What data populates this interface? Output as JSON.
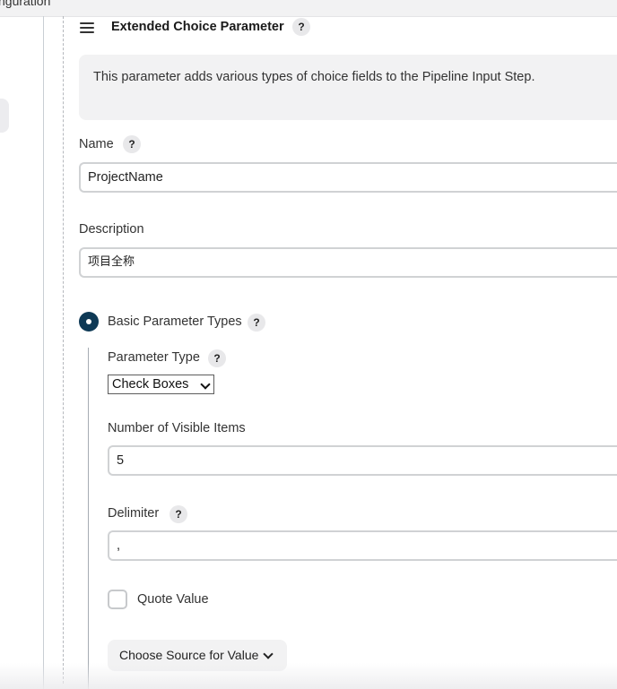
{
  "header": {
    "fragment_text": "nguration"
  },
  "section": {
    "title": "Extended Choice Parameter",
    "help": "?",
    "description": "This parameter adds various types of choice fields to the Pipeline Input Step."
  },
  "name_field": {
    "label": "Name",
    "help": "?",
    "value": "ProjectName"
  },
  "description_field": {
    "label": "Description",
    "value": "项目全称"
  },
  "basic_types": {
    "label": "Basic Parameter Types",
    "help": "?",
    "selected": true,
    "parameter_type": {
      "label": "Parameter Type",
      "help": "?",
      "selected_value": "Check Boxes"
    },
    "visible_items": {
      "label": "Number of Visible Items",
      "value": "5"
    },
    "delimiter": {
      "label": "Delimiter",
      "help": "?",
      "value": ","
    },
    "quote_value": {
      "label": "Quote Value",
      "checked": false
    },
    "source_button": {
      "label": "Choose Source for Value"
    }
  },
  "icons": {
    "drag_handle": "drag-handle-icon",
    "help": "help-icon",
    "radio": "radio-selected-icon",
    "chevron": "chevron-down-icon"
  },
  "colors": {
    "radio_accent": "#0e3955",
    "panel_bg": "#f2f2f3",
    "border": "#d0d2d4"
  }
}
